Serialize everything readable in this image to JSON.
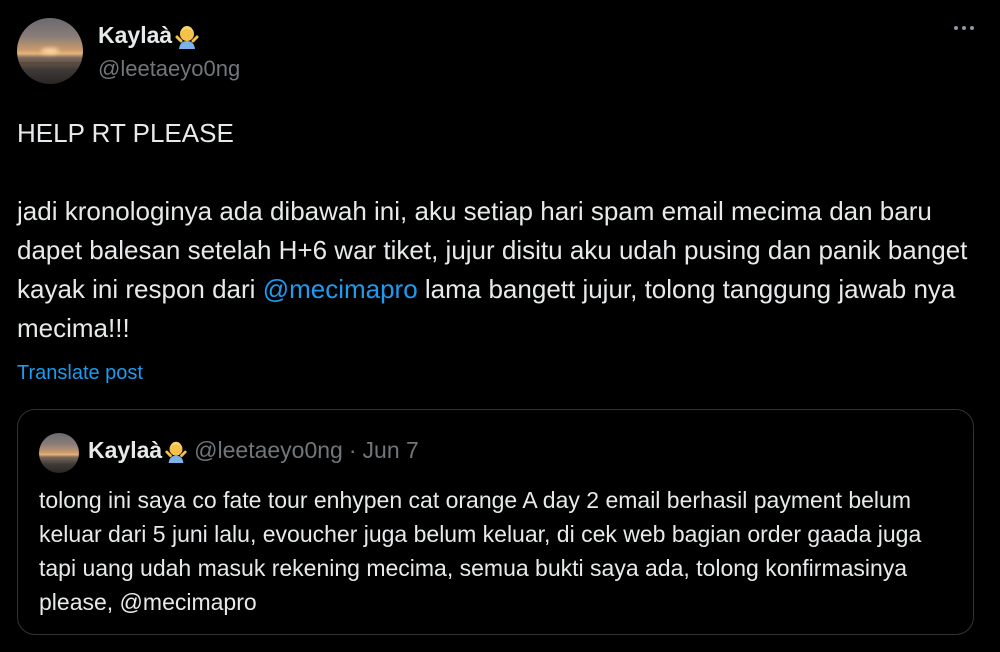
{
  "author": {
    "display_name": "Kaylaà",
    "handle": "@leetaeyo0ng"
  },
  "tweet": {
    "line1": "HELP RT PLEASE",
    "para_before_mention": "jadi kronologinya ada dibawah ini, aku setiap hari spam email mecima dan baru dapet balesan setelah H+6 war tiket, jujur disitu aku udah pusing dan panik banget kayak ini respon dari ",
    "mention": "@mecimapro",
    "para_after_mention": " lama bangett jujur, tolong tanggung jawab nya mecima!!!",
    "translate_label": "Translate post"
  },
  "quote": {
    "display_name": "Kaylaà",
    "handle": "@leetaeyo0ng",
    "separator": "·",
    "date": "Jun 7",
    "text": "tolong ini saya co fate tour enhypen cat orange A day 2  email berhasil payment belum keluar dari 5 juni lalu, evoucher juga belum keluar, di cek web bagian order gaada juga tapi uang udah masuk rekening mecima, semua bukti saya ada, tolong konfirmasinya please, @mecimapro"
  },
  "colors": {
    "background": "#000000",
    "text": "#e7e9ea",
    "secondary": "#71767b",
    "accent": "#1d9bf0",
    "border": "#2f3336"
  },
  "icons": [
    "person-gesturing-emoji-icon",
    "more-icon"
  ]
}
